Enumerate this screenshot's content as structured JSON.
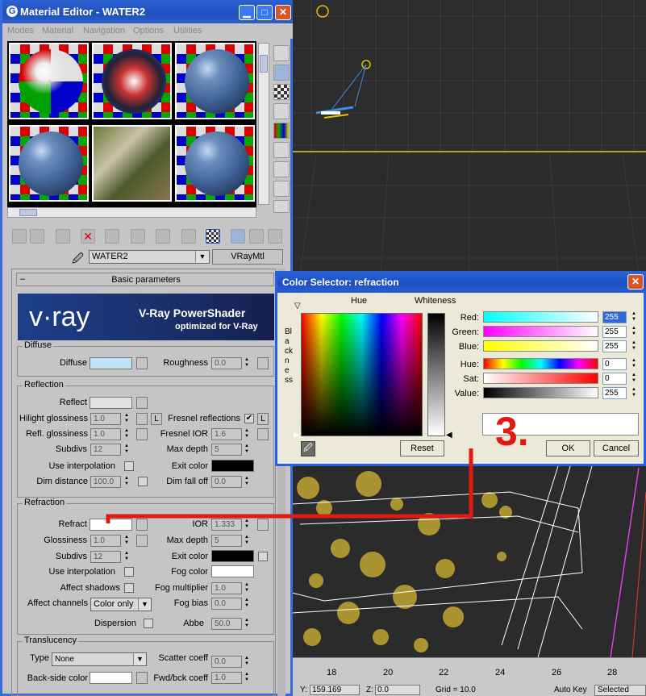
{
  "material_editor": {
    "title": "Material Editor - WATER2",
    "menu": [
      "Modes",
      "Material",
      "Navigation",
      "Options",
      "Utilities"
    ],
    "material_name": "WATER2",
    "material_type": "VRayMtl",
    "rollout_title": "Basic parameters",
    "banner": {
      "logo": "v·ray",
      "title": "V-Ray PowerShader",
      "subtitle": "optimized for V-Ray"
    },
    "diffuse": {
      "group": "Diffuse",
      "diffuse_label": "Diffuse",
      "roughness_label": "Roughness",
      "roughness": "0.0"
    },
    "reflection": {
      "group": "Reflection",
      "reflect_label": "Reflect",
      "hilight_label": "Hilight glossiness",
      "hilight": "1.0",
      "lock": "L",
      "fresnel_label": "Fresnel reflections",
      "fresnel_lock": "L",
      "refl_gloss_label": "Refl. glossiness",
      "refl_gloss": "1.0",
      "fresnel_ior_label": "Fresnel IOR",
      "fresnel_ior": "1.6",
      "subdivs_label": "Subdivs",
      "subdivs": "12",
      "max_depth_label": "Max depth",
      "max_depth": "5",
      "use_interp_label": "Use interpolation",
      "exit_color_label": "Exit color",
      "dim_dist_label": "Dim distance",
      "dim_dist": "100.0",
      "dim_falloff_label": "Dim fall off",
      "dim_falloff": "0.0"
    },
    "refraction": {
      "group": "Refraction",
      "refract_label": "Refract",
      "ior_label": "IOR",
      "ior": "1.333",
      "glossiness_label": "Glossiness",
      "glossiness": "1.0",
      "max_depth_label": "Max depth",
      "max_depth": "5",
      "subdivs_label": "Subdivs",
      "subdivs": "12",
      "exit_color_label": "Exit color",
      "use_interp_label": "Use interpolation",
      "fog_color_label": "Fog color",
      "affect_shadows_label": "Affect shadows",
      "fog_mult_label": "Fog multiplier",
      "fog_mult": "1.0",
      "affect_channels_label": "Affect channels",
      "affect_channels": "Color only",
      "fog_bias_label": "Fog bias",
      "fog_bias": "0.0",
      "dispersion_label": "Dispersion",
      "abbe_label": "Abbe",
      "abbe": "50.0"
    },
    "translucency": {
      "group": "Translucency",
      "type_label": "Type",
      "type": "None",
      "scatter_label": "Scatter coeff",
      "scatter": "0.0",
      "backside_label": "Back-side color",
      "fwd_label": "Fwd/bck coeff",
      "fwd": "1.0"
    }
  },
  "color_selector": {
    "title": "Color Selector: refraction",
    "hue_header": "Hue",
    "whiteness_header": "Whiteness",
    "blackness_label": "Blackness",
    "channels": [
      {
        "label": "Red:",
        "value": "255"
      },
      {
        "label": "Green:",
        "value": "255"
      },
      {
        "label": "Blue:",
        "value": "255"
      },
      {
        "label": "Hue:",
        "value": "0"
      },
      {
        "label": "Sat:",
        "value": "0"
      },
      {
        "label": "Value:",
        "value": "255"
      }
    ],
    "reset": "Reset",
    "ok": "OK",
    "cancel": "Cancel"
  },
  "annotation": "3.",
  "timeline": {
    "ticks": [
      "18",
      "20",
      "22",
      "24",
      "26",
      "28"
    ]
  },
  "status": {
    "y_label": "Y:",
    "y": "159.169",
    "z_label": "Z:",
    "z": "0.0",
    "grid": "Grid = 10.0",
    "auto_key": "Auto Key",
    "selected": "Selected"
  },
  "colors": {
    "accent": "#2c61d0",
    "annotation_red": "#e01a10",
    "wire_yellow": "#b8a032"
  }
}
